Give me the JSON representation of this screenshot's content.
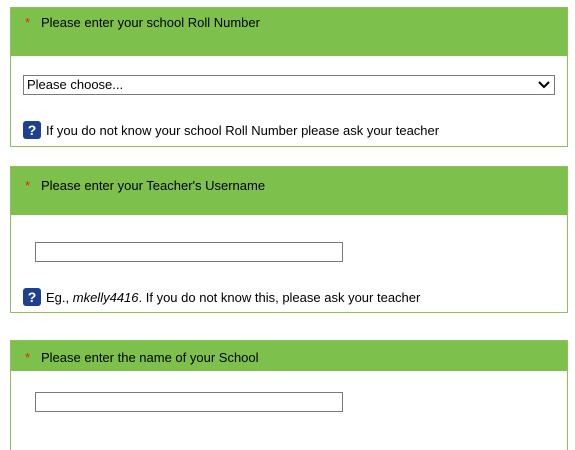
{
  "required_marker": "*",
  "roll_number": {
    "heading": "Please enter your school Roll Number",
    "select_value": "Please choose...",
    "help_text": "If you do not know your school Roll Number please ask your teacher"
  },
  "teacher_username": {
    "heading": "Please enter your Teacher's Username",
    "input_value": "",
    "help_prefix": "Eg., ",
    "help_example": "mkelly4416",
    "help_suffix": ". If you do not know this, please ask your teacher"
  },
  "school_name": {
    "heading": "Please enter the name of your School",
    "input_value": ""
  },
  "help_icon_glyph": "?",
  "colors": {
    "header_green": "#7dc04b",
    "asterisk_red": "#e8211b",
    "help_icon_blue": "#1f3f8f"
  },
  "icons": {
    "help": "help-icon",
    "dropdown": "chevron-down-icon"
  }
}
